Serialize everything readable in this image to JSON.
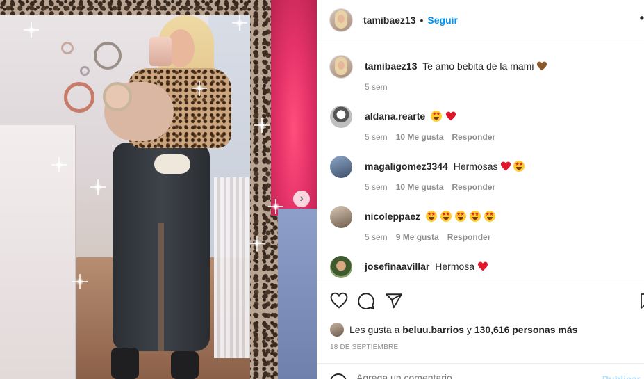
{
  "post": {
    "username": "tamibaez13",
    "follow_label": "Seguir",
    "separator": "•",
    "more_label": "..."
  },
  "comments": [
    {
      "username": "tamibaez13",
      "text": "Te amo bebita de la mami",
      "emojis": [
        "brown-heart"
      ],
      "time": "5 sem",
      "likes": "",
      "reply": ""
    },
    {
      "username": "aldana.rearte",
      "text": "",
      "emojis": [
        "star-struck",
        "red-heart"
      ],
      "time": "5 sem",
      "likes": "10 Me gusta",
      "reply": "Responder"
    },
    {
      "username": "magaligomez3344",
      "text": "Hermosas",
      "emojis": [
        "red-heart",
        "star-struck"
      ],
      "time": "5 sem",
      "likes": "10 Me gusta",
      "reply": "Responder"
    },
    {
      "username": "nicoleppaez",
      "text": "",
      "emojis": [
        "star-struck",
        "star-struck",
        "star-struck",
        "star-struck",
        "star-struck"
      ],
      "time": "5 sem",
      "likes": "9 Me gusta",
      "reply": "Responder"
    },
    {
      "username": "josefinaavillar",
      "text": "Hermosa",
      "emojis": [
        "red-heart"
      ],
      "time": "",
      "likes": "",
      "reply": ""
    }
  ],
  "likes": {
    "prefix": "Les gusta a",
    "first_user": "beluu.barrios",
    "connector": "y",
    "count_text": "130,616 personas más"
  },
  "date": "18 DE SEPTIEMBRE",
  "add_comment": {
    "placeholder": "Agrega un comentario...",
    "publish_label": "Publicar"
  },
  "colors": {
    "accent": "#0095f6",
    "red_heart": "#ed4956",
    "brown_heart": "#8a5a2b",
    "muted": "#8e8e8e"
  },
  "icons": [
    "heart-icon",
    "comment-icon",
    "share-icon",
    "bookmark-icon",
    "chevron-right-icon",
    "emoji-icon",
    "more-icon"
  ]
}
